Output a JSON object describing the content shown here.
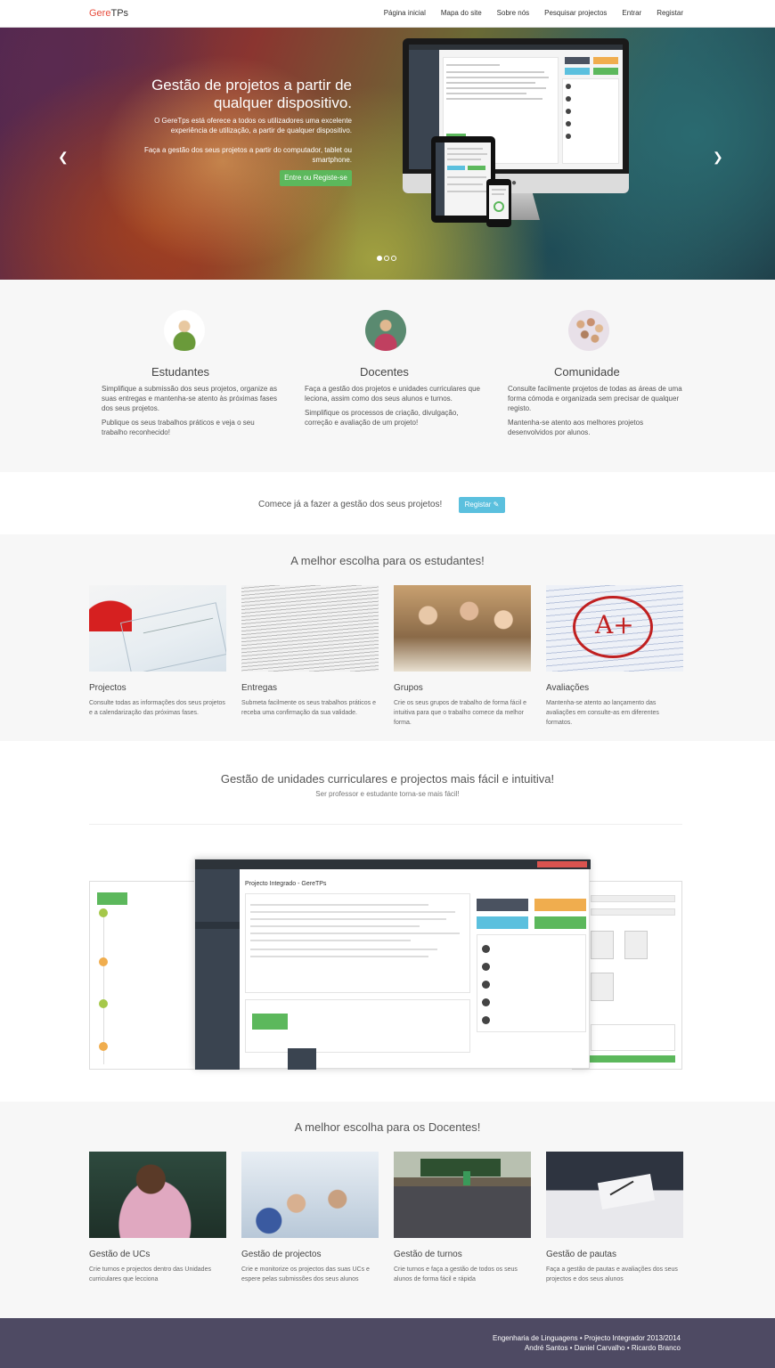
{
  "nav": {
    "brand_part1": "Gere",
    "brand_part2": "TPs",
    "links": [
      "Página inicial",
      "Mapa do site",
      "Sobre nós",
      "Pesquisar projectos",
      "Entrar",
      "Registar"
    ]
  },
  "hero": {
    "title": "Gestão de projetos a partir de qualquer dispositivo.",
    "paragraph1": "O GereTps está oferece a todos os utilizadores uma excelente experiência de utilização, a partir de qualquer dispositivo.",
    "paragraph2": "Faça a gestão dos seus projetos a partir do computador, tablet ou smartphone.",
    "button": "Entre ou Registe-se",
    "prev_icon": "chevron-left-icon",
    "next_icon": "chevron-right-icon"
  },
  "features": [
    {
      "title": "Estudantes",
      "p1": "Simplifique a submissão dos seus projetos, organize as suas entregas e mantenha-se atento às próximas fases dos seus projetos.",
      "p2": "Publique os seus trabalhos práticos e veja o seu trabalho reconhecido!"
    },
    {
      "title": "Docentes",
      "p1": "Faça a gestão dos projetos e unidades curriculares que leciona, assim como dos seus alunos e turnos.",
      "p2": "Simplifique os processos de criação, divulgação, correção e avaliação de um projeto!"
    },
    {
      "title": "Comunidade",
      "p1": "Consulte facilmente projetos de todas as áreas de uma forma cómoda e organizada sem precisar de qualquer registo.",
      "p2": "Mantenha-se atento aos melhores projetos desenvolvidos por alunos."
    }
  ],
  "cta": {
    "text": "Comece já a fazer a gestão dos seus projetos!",
    "button": "Registar ✎"
  },
  "students": {
    "title": "A melhor escolha para os estudantes!",
    "cards": [
      {
        "title": "Projectos",
        "text": "Consulte todas as informações dos seus projetos e a calendarização das próximas fases."
      },
      {
        "title": "Entregas",
        "text": "Submeta facilmente os seus trabalhos práticos e receba uma confirmação da sua validade."
      },
      {
        "title": "Grupos",
        "text": "Crie os seus grupos de trabalho de forma fácil e intuitiva para que o trabalho comece da melhor forma."
      },
      {
        "title": "Avaliações",
        "text": "Mantenha-se atento ao lançamento das avaliações em consulte-as em diferentes formatos."
      }
    ]
  },
  "management": {
    "title": "Gestão de unidades curriculares e projectos mais fácil e intuitiva!",
    "subtitle": "Ser professor e estudante torna-se mais fácil!",
    "screenshot_title": "Projecto Integrado - GereTPs"
  },
  "teachers": {
    "title": "A melhor escolha para os Docentes!",
    "cards": [
      {
        "title": "Gestão de UCs",
        "text": "Crie turnos e projectos dentro das Unidades curriculares que lecciona"
      },
      {
        "title": "Gestão de projectos",
        "text": "Crie e monitorize os projectos das suas UCs e espere pelas submissões dos seus alunos"
      },
      {
        "title": "Gestão de turnos",
        "text": "Crie turnos e faça a gestão de todos os seus alunos de forma fácil e rápida"
      },
      {
        "title": "Gestão de pautas",
        "text": "Faça a gestão de pautas e avaliações dos seus projectos e dos seus alunos"
      }
    ]
  },
  "footer": {
    "line1": "Engenharia de Linguagens • Projecto Integrador 2013/2014",
    "line2": "André Santos • Daniel Carvalho • Ricardo Branco"
  },
  "colors": {
    "brand_red": "#e74c3c",
    "success": "#5cb85c",
    "info": "#5bc0de",
    "footer_bg": "#4e4a63"
  }
}
